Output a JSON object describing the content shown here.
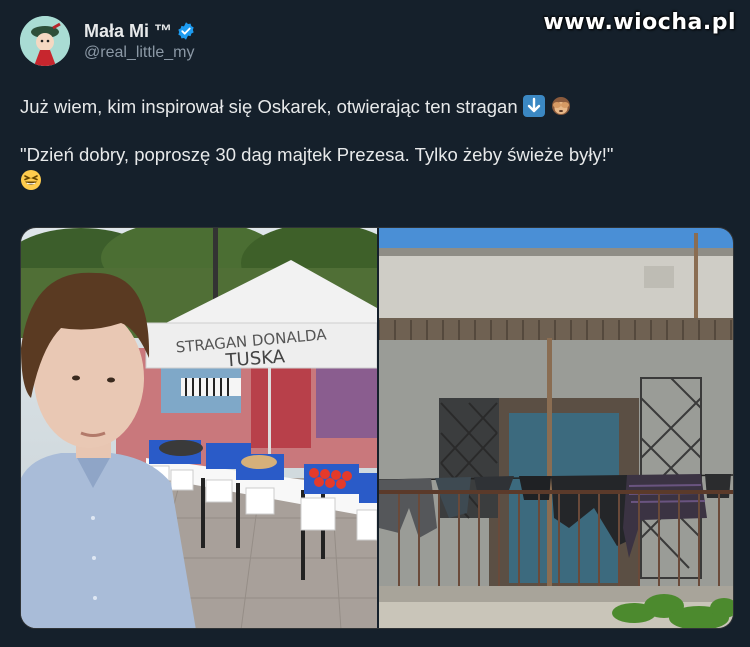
{
  "watermark": "www.wiocha.pl",
  "user": {
    "display_name": "Mała Mi ™",
    "handle": "@real_little_my",
    "verified": true,
    "avatar_icon": "moomin-little-my-avatar"
  },
  "tweet": {
    "line1": "Już wiem, kim inspirował się Oskarek, otwierając ten stragan",
    "line1_emojis": [
      "down-arrow-emoji",
      "see-no-evil-monkey-emoji"
    ],
    "line2": "\"Dzień dobry, poproszę 30 dag majtek Prezesa. Tylko żeby świeże były!\"",
    "line2_emoji": "grinning-squinting-face-emoji"
  },
  "media": {
    "left_photo": {
      "tent_sign_line1": "STRAGAN DONALDA",
      "tent_sign_line2": "TUSKA"
    },
    "right_photo": {}
  },
  "colors": {
    "background": "#15202b",
    "text": "#e7e9ea",
    "secondary_text": "#8b98a5",
    "verified_blue": "#1d9bf0"
  }
}
